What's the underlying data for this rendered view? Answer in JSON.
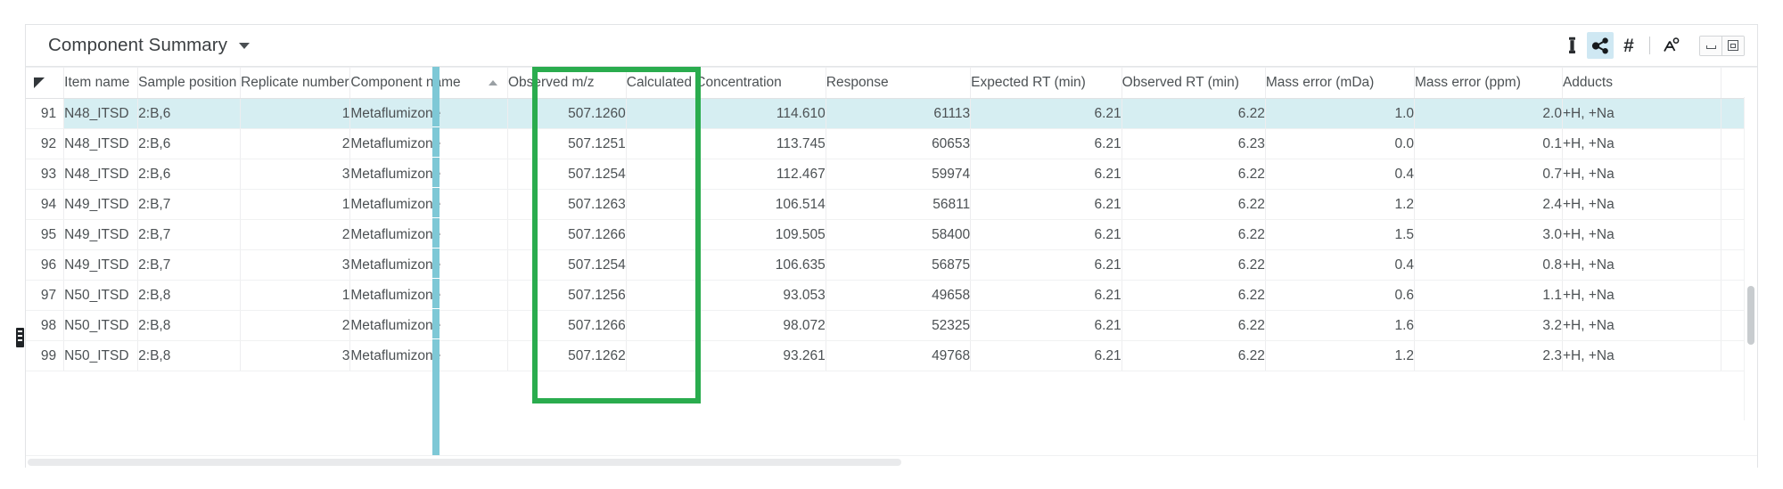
{
  "window": {
    "title": "Component Summary",
    "caret": "dropdown-caret"
  },
  "toolbar": {
    "icons": [
      {
        "name": "vial-icon",
        "label": "Vial",
        "active": false
      },
      {
        "name": "molecule-icon",
        "label": "Molecule",
        "active": true
      },
      {
        "name": "hash-icon",
        "label": "#",
        "active": false
      },
      {
        "name": "molecule-settings-icon",
        "label": "Molecule settings",
        "active": false
      }
    ],
    "window_buttons": [
      {
        "name": "minimize-button",
        "label": "Minimize"
      },
      {
        "name": "restore-button",
        "label": "Restore"
      }
    ]
  },
  "table": {
    "sort": {
      "column": "Component name",
      "direction": "ascending"
    },
    "highlighted_column": "Calculated Concentration",
    "highlight_color": "#2aac4e",
    "selected_row_index": 0,
    "selection_color": "#d6eef2",
    "freeze_divider_color": "#7ec8d6",
    "columns": [
      {
        "key": "row",
        "label": "",
        "align": "right"
      },
      {
        "key": "item_name",
        "label": "Item name",
        "align": "left"
      },
      {
        "key": "sample_position",
        "label": "Sample position",
        "align": "left"
      },
      {
        "key": "replicate_number",
        "label": "Replicate number",
        "align": "right"
      },
      {
        "key": "component_name",
        "label": "Component name",
        "align": "left"
      },
      {
        "key": "observed_mz",
        "label": "Observed m/z",
        "align": "right"
      },
      {
        "key": "calculated_concentration",
        "label": "Calculated Concentration",
        "align": "right"
      },
      {
        "key": "response",
        "label": "Response",
        "align": "right"
      },
      {
        "key": "expected_rt",
        "label": "Expected RT (min)",
        "align": "right"
      },
      {
        "key": "observed_rt",
        "label": "Observed RT (min)",
        "align": "right"
      },
      {
        "key": "mass_error_mda",
        "label": "Mass error (mDa)",
        "align": "right"
      },
      {
        "key": "mass_error_ppm",
        "label": "Mass error (ppm)",
        "align": "right"
      },
      {
        "key": "adducts",
        "label": "Adducts",
        "align": "left"
      },
      {
        "key": "trailing",
        "label": "",
        "align": "left"
      }
    ],
    "rows": [
      {
        "row": "91",
        "item_name": "N48_ITSD",
        "sample_position": "2:B,6",
        "replicate_number": "1",
        "component_name": "Metaflumizone",
        "observed_mz": "507.1260",
        "calculated_concentration": "114.610",
        "response": "61113",
        "expected_rt": "6.21",
        "observed_rt": "6.22",
        "mass_error_mda": "1.0",
        "mass_error_ppm": "2.0",
        "adducts": "+H, +Na",
        "trailing": ""
      },
      {
        "row": "92",
        "item_name": "N48_ITSD",
        "sample_position": "2:B,6",
        "replicate_number": "2",
        "component_name": "Metaflumizone",
        "observed_mz": "507.1251",
        "calculated_concentration": "113.745",
        "response": "60653",
        "expected_rt": "6.21",
        "observed_rt": "6.23",
        "mass_error_mda": "0.0",
        "mass_error_ppm": "0.1",
        "adducts": "+H, +Na",
        "trailing": ""
      },
      {
        "row": "93",
        "item_name": "N48_ITSD",
        "sample_position": "2:B,6",
        "replicate_number": "3",
        "component_name": "Metaflumizone",
        "observed_mz": "507.1254",
        "calculated_concentration": "112.467",
        "response": "59974",
        "expected_rt": "6.21",
        "observed_rt": "6.22",
        "mass_error_mda": "0.4",
        "mass_error_ppm": "0.7",
        "adducts": "+H, +Na",
        "trailing": ""
      },
      {
        "row": "94",
        "item_name": "N49_ITSD",
        "sample_position": "2:B,7",
        "replicate_number": "1",
        "component_name": "Metaflumizone",
        "observed_mz": "507.1263",
        "calculated_concentration": "106.514",
        "response": "56811",
        "expected_rt": "6.21",
        "observed_rt": "6.22",
        "mass_error_mda": "1.2",
        "mass_error_ppm": "2.4",
        "adducts": "+H, +Na",
        "trailing": ""
      },
      {
        "row": "95",
        "item_name": "N49_ITSD",
        "sample_position": "2:B,7",
        "replicate_number": "2",
        "component_name": "Metaflumizone",
        "observed_mz": "507.1266",
        "calculated_concentration": "109.505",
        "response": "58400",
        "expected_rt": "6.21",
        "observed_rt": "6.22",
        "mass_error_mda": "1.5",
        "mass_error_ppm": "3.0",
        "adducts": "+H, +Na",
        "trailing": ""
      },
      {
        "row": "96",
        "item_name": "N49_ITSD",
        "sample_position": "2:B,7",
        "replicate_number": "3",
        "component_name": "Metaflumizone",
        "observed_mz": "507.1254",
        "calculated_concentration": "106.635",
        "response": "56875",
        "expected_rt": "6.21",
        "observed_rt": "6.22",
        "mass_error_mda": "0.4",
        "mass_error_ppm": "0.8",
        "adducts": "+H, +Na",
        "trailing": ""
      },
      {
        "row": "97",
        "item_name": "N50_ITSD",
        "sample_position": "2:B,8",
        "replicate_number": "1",
        "component_name": "Metaflumizone",
        "observed_mz": "507.1256",
        "calculated_concentration": "93.053",
        "response": "49658",
        "expected_rt": "6.21",
        "observed_rt": "6.22",
        "mass_error_mda": "0.6",
        "mass_error_ppm": "1.1",
        "adducts": "+H, +Na",
        "trailing": ""
      },
      {
        "row": "98",
        "item_name": "N50_ITSD",
        "sample_position": "2:B,8",
        "replicate_number": "2",
        "component_name": "Metaflumizone",
        "observed_mz": "507.1266",
        "calculated_concentration": "98.072",
        "response": "52325",
        "expected_rt": "6.21",
        "observed_rt": "6.22",
        "mass_error_mda": "1.6",
        "mass_error_ppm": "3.2",
        "adducts": "+H, +Na",
        "trailing": ""
      },
      {
        "row": "99",
        "item_name": "N50_ITSD",
        "sample_position": "2:B,8",
        "replicate_number": "3",
        "component_name": "Metaflumizone",
        "observed_mz": "507.1262",
        "calculated_concentration": "93.261",
        "response": "49768",
        "expected_rt": "6.21",
        "observed_rt": "6.22",
        "mass_error_mda": "1.2",
        "mass_error_ppm": "2.3",
        "adducts": "+H, +Na",
        "trailing": ""
      }
    ]
  }
}
